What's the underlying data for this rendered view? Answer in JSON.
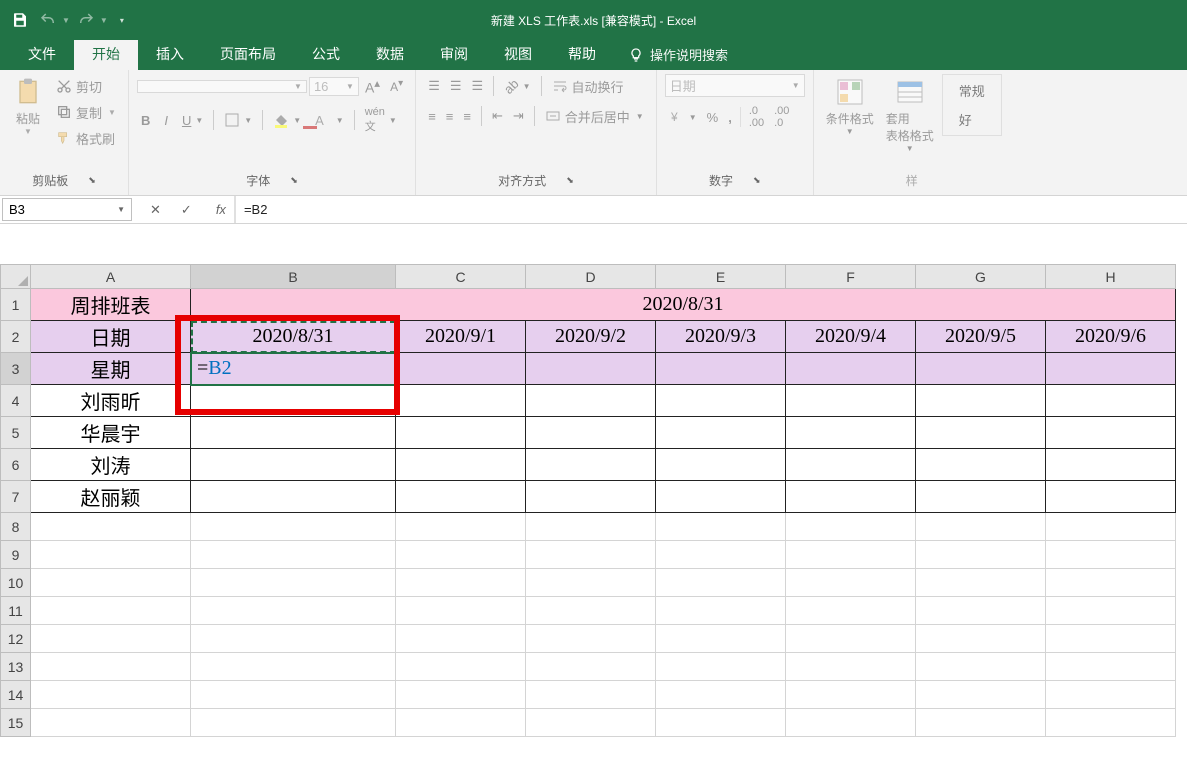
{
  "window": {
    "title": "新建 XLS 工作表.xls  [兼容模式]  -  Excel"
  },
  "tabs": {
    "file": "文件",
    "home": "开始",
    "insert": "插入",
    "layout": "页面布局",
    "formulas": "公式",
    "data": "数据",
    "review": "审阅",
    "view": "视图",
    "help": "帮助",
    "tellme": "操作说明搜索"
  },
  "ribbon": {
    "clipboard": {
      "paste": "粘贴",
      "cut": "剪切",
      "copy": "复制",
      "painter": "格式刷",
      "label": "剪贴板"
    },
    "font": {
      "family_ph": "",
      "size": "16",
      "label": "字体"
    },
    "align": {
      "merge": "合并后居中",
      "wrap": "自动换行",
      "label": "对齐方式"
    },
    "number": {
      "format": "日期",
      "label": "数字"
    },
    "styles": {
      "cond": "条件格式",
      "table": "套用\n表格格式",
      "cell": "常规",
      "bad": "好",
      "label": "样"
    }
  },
  "formula_bar": {
    "name_box": "B3",
    "formula": "=B2"
  },
  "editing_cell": {
    "eq": "=",
    "ref": "B2"
  },
  "sheet": {
    "col_headers": [
      "A",
      "B",
      "C",
      "D",
      "E",
      "F",
      "G",
      "H"
    ],
    "row_headers": [
      "1",
      "2",
      "3",
      "4",
      "5",
      "6",
      "7",
      "8",
      "9",
      "10",
      "11",
      "12",
      "13",
      "14",
      "15"
    ],
    "r1": {
      "A": "周排班表",
      "merged": "2020/8/31"
    },
    "r2": {
      "A": "日期",
      "B": "2020/8/31",
      "C": "2020/9/1",
      "D": "2020/9/2",
      "E": "2020/9/3",
      "F": "2020/9/4",
      "G": "2020/9/5",
      "H": "2020/9/6"
    },
    "r3": {
      "A": "星期"
    },
    "r4": {
      "A": "刘雨昕"
    },
    "r5": {
      "A": "华晨宇"
    },
    "r6": {
      "A": "刘涛"
    },
    "r7": {
      "A": "赵丽颖"
    }
  }
}
